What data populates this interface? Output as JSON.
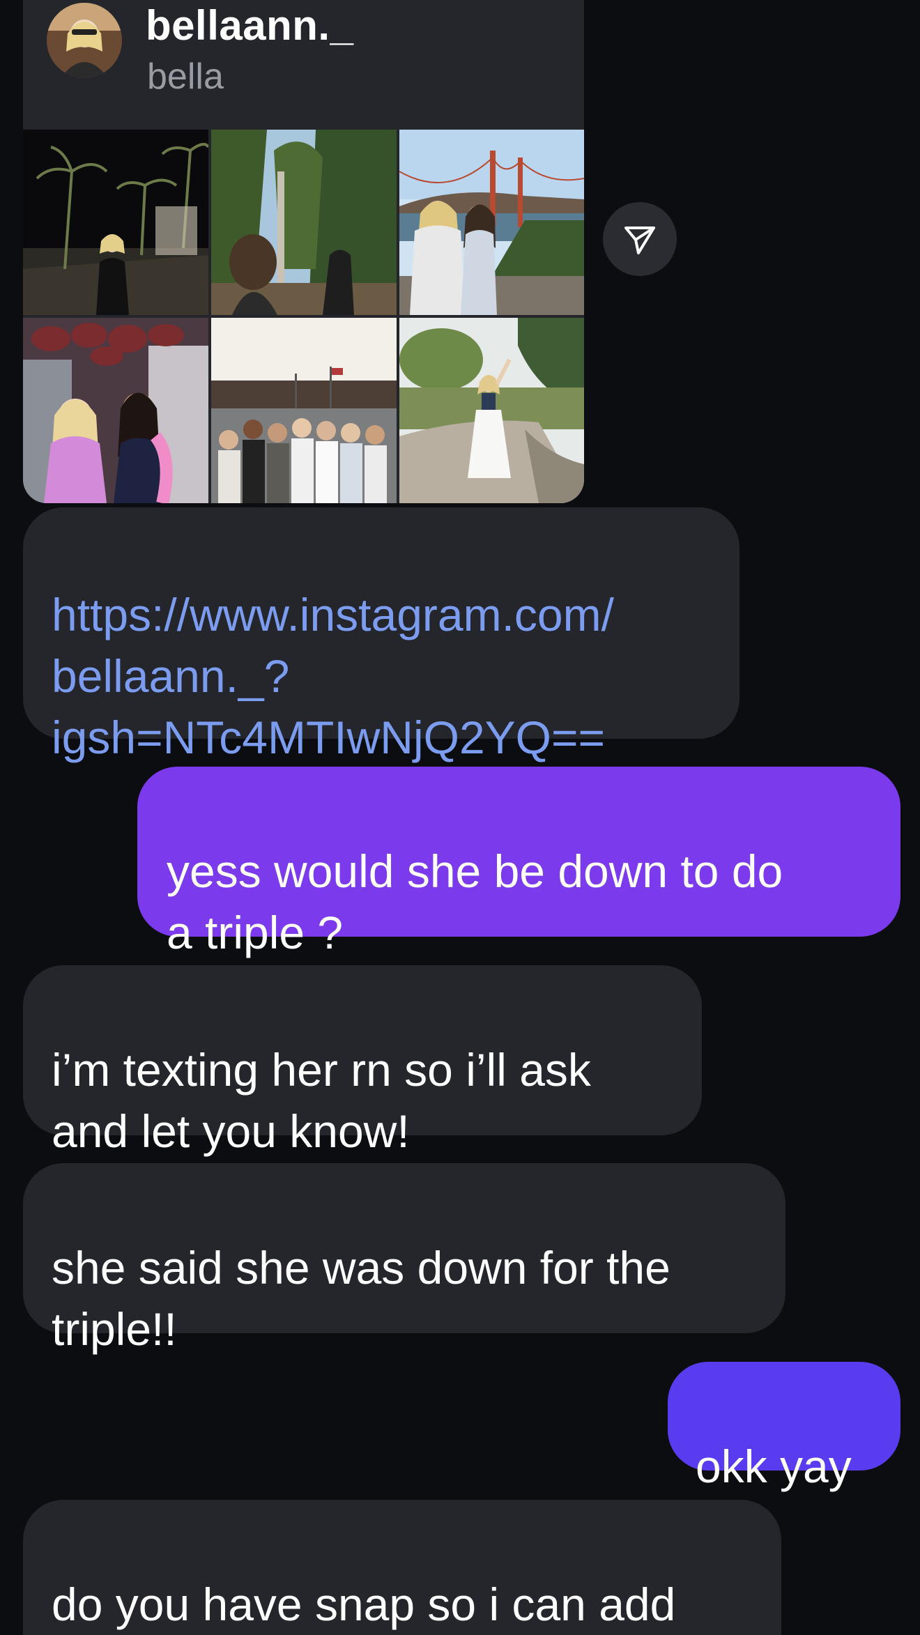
{
  "profile_card": {
    "username": "bellaann._",
    "display_name": "bella"
  },
  "share_button": {
    "icon": "send-icon"
  },
  "messages": [
    {
      "direction": "incoming",
      "type": "link",
      "text": "https://www.instagram.com/\nbellaann._?\nigsh=NTc4MTIwNjQ2YQ=="
    },
    {
      "direction": "outgoing",
      "text": "yess would she be down to do\na triple ?"
    },
    {
      "direction": "incoming",
      "text": "i’m texting her rn so i’ll ask\nand let you know!"
    },
    {
      "direction": "incoming",
      "text": "she said she was down for the\ntriple!!"
    },
    {
      "direction": "outgoing",
      "text": "okk yay"
    },
    {
      "direction": "incoming",
      "text": "do you have snap so i can add\nus all in a gc?"
    }
  ],
  "colors": {
    "background": "#0c0d11",
    "incoming_bubble": "#24262c",
    "outgoing_bubble_purple": "#7c3aed",
    "outgoing_bubble_indigo": "#5a3cf0",
    "link_text": "#7c9cf0"
  }
}
